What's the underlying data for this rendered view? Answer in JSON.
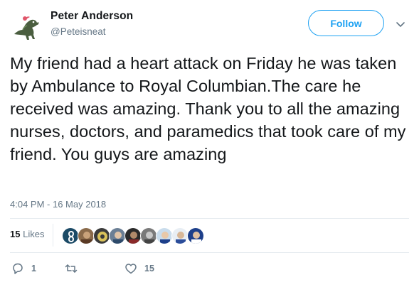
{
  "author": {
    "display_name": "Peter Anderson",
    "handle": "@Peteisneat",
    "avatar_icon": "dinosaur-avatar-icon"
  },
  "follow_button": {
    "label": "Follow"
  },
  "menu_icon": "chevron-down-icon",
  "tweet": {
    "text": "My friend had a heart attack on Friday he was taken by Ambulance to Royal Columbian.The care he received was amazing. Thank you to all the amazing nurses, doctors, and paramedics that took care of my friend. You guys are amazing",
    "timestamp": "4:04 PM - 16 May 2018"
  },
  "stats": {
    "likes_count": "15",
    "likes_label": "Likes",
    "liker_avatars": [
      "liker-avatar-1",
      "liker-avatar-2",
      "liker-avatar-3",
      "liker-avatar-4",
      "liker-avatar-5",
      "liker-avatar-6",
      "liker-avatar-7",
      "liker-avatar-8",
      "liker-avatar-9"
    ]
  },
  "actions": {
    "reply_count": "1",
    "retweet_count": "",
    "like_count": "15"
  },
  "colors": {
    "accent": "#1da1f2",
    "secondary_text": "#657786",
    "primary_text": "#14171a",
    "divider": "#e6ecf0"
  }
}
